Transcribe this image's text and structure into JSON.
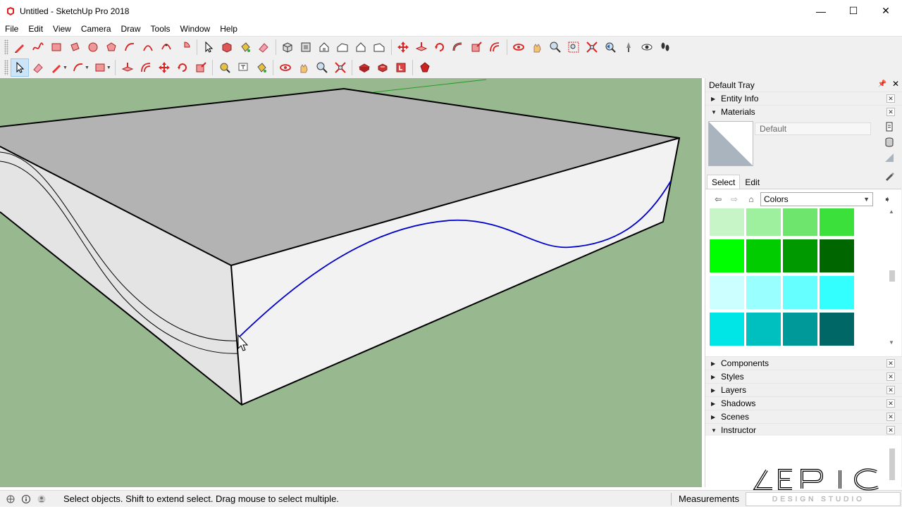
{
  "window": {
    "title": "Untitled - SketchUp Pro 2018",
    "minimize_glyph": "—",
    "maximize_glyph": "☐",
    "close_glyph": "✕"
  },
  "menu": [
    "File",
    "Edit",
    "View",
    "Camera",
    "Draw",
    "Tools",
    "Window",
    "Help"
  ],
  "tray": {
    "title": "Default Tray",
    "panels": {
      "entity_info": "Entity Info",
      "materials": "Materials",
      "components": "Components",
      "styles": "Styles",
      "layers": "Layers",
      "shadows": "Shadows",
      "scenes": "Scenes",
      "instructor": "Instructor"
    },
    "materials": {
      "current_name": "Default",
      "tab_select": "Select",
      "tab_edit": "Edit",
      "collection": "Colors",
      "swatches": [
        [
          "#c8f5c8",
          "#9ef09e",
          "#6ee66e",
          "#3be03b"
        ],
        [
          "#00ff00",
          "#00cc00",
          "#009900",
          "#006600"
        ],
        [
          "#ccffff",
          "#99ffff",
          "#66ffff",
          "#33ffff"
        ],
        [
          "#00e5e5",
          "#00bfbf",
          "#009999",
          "#006666"
        ]
      ]
    }
  },
  "status": {
    "message": "Select objects. Shift to extend select. Drag mouse to select multiple.",
    "measurements_label": "Measurements"
  },
  "watermark": {
    "text": "EPIC",
    "subtext": "DESIGN STUDIO"
  },
  "colors": {
    "viewport_bg": "#98b890",
    "curve": "#0000cc",
    "top_face": "#b3b3b3",
    "side_face": "#f2f2f2",
    "left_face": "#e4e4e4"
  }
}
